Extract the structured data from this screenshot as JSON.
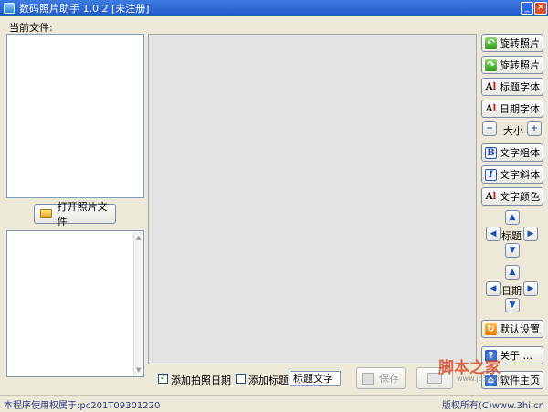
{
  "window": {
    "title": "数码照片助手 1.0.2 [未注册]",
    "min_label": "_",
    "close_label": "✕"
  },
  "left": {
    "current_file_label": "当前文件:",
    "open_button_label": "打开照片文件"
  },
  "right_buttons": {
    "rotate_left": "旋转照片",
    "rotate_right": "旋转照片",
    "title_font": "标题字体",
    "date_font": "日期字体",
    "size_label": "大小",
    "size_minus": "−",
    "size_plus": "+",
    "bold": "文字粗体",
    "italic": "文字斜体",
    "color": "文字颜色",
    "title_pad_label": "标题",
    "date_pad_label": "日期",
    "reset": "默认设置",
    "about": "关于 ...",
    "home": "软件主页"
  },
  "bottom": {
    "add_date_label": "添加拍照日期",
    "add_date_checked": true,
    "add_title_label": "添加标题:",
    "add_title_checked": false,
    "title_input_value": "标题文字",
    "save_label": "保存"
  },
  "status": {
    "left": "本程序使用权属于:pc201T09301220",
    "right": "版权所有(C)www.3hi.cn"
  },
  "watermark": {
    "text": "脚本之家",
    "sub": "www.jb51.net"
  }
}
